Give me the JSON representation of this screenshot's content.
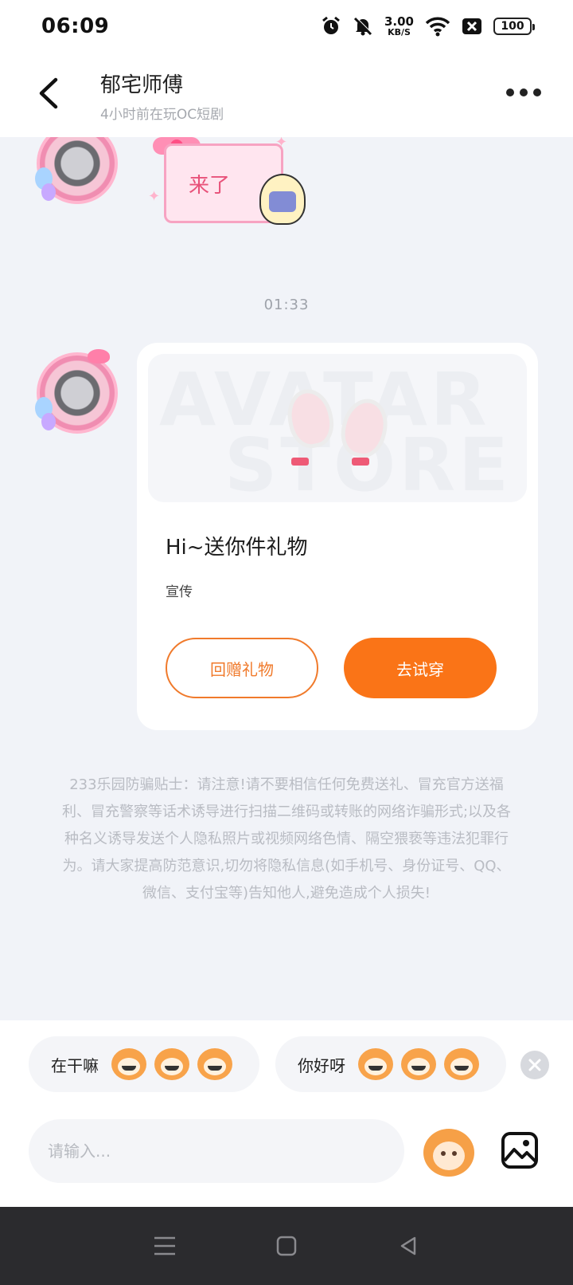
{
  "status_bar": {
    "time": "06:09",
    "net_speed_value": "3.00",
    "net_speed_unit": "KB/S",
    "battery": "100",
    "icons": [
      "alarm-icon",
      "mute-icon",
      "wifi-icon",
      "sim-off-icon",
      "battery-icon"
    ]
  },
  "header": {
    "title": "郁宅师傅",
    "subtitle": "4小时前在玩OC短剧",
    "back_icon": "chevron-left-icon",
    "more_icon": "more-dots-icon"
  },
  "chat": {
    "sticker_text": "来了",
    "timestamp": "01:33",
    "gift_card": {
      "banner_word_1": "AVATAR",
      "banner_word_2": "STORE",
      "title": "Hi~送你件礼物",
      "tag": "宣传",
      "return_gift_label": "回赠礼物",
      "try_on_label": "去试穿"
    },
    "notice": "233乐园防骗贴士：请注意!请不要相信任何免费送礼、冒充官方送福利、冒充警察等话术诱导进行扫描二维码或转账的网络诈骗形式;以及各种名义诱导发送个人隐私照片或视频网络色情、隔空猥亵等违法犯罪行为。请大家提高防范意识,切勿将隐私信息(如手机号、身份证号、QQ、微信、支付宝等)告知他人,避免造成个人损失!"
  },
  "quick_replies": [
    {
      "label": "在干嘛"
    },
    {
      "label": "你好呀"
    }
  ],
  "input": {
    "placeholder": "请输入..."
  },
  "colors": {
    "accent_orange": "#fa7417",
    "outline_orange": "#f07a2b",
    "background": "#f1f3f8"
  }
}
